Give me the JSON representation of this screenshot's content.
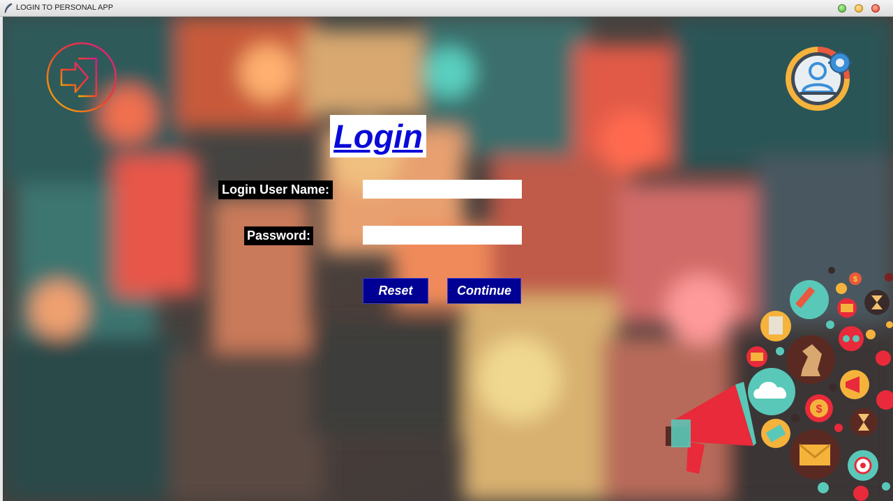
{
  "window": {
    "title": "LOGIN TO PERSONAL APP"
  },
  "login": {
    "heading": "Login",
    "username_label": "Login User Name:",
    "username_value": "",
    "password_label": "Password:",
    "password_value": "",
    "reset_label": "Reset",
    "continue_label": "Continue"
  },
  "colors": {
    "heading_text": "#0a0ad8",
    "button_bg": "#000094",
    "label_bg": "#000000"
  },
  "icons": [
    "feather-app-icon",
    "logout-icon",
    "user-settings-icon",
    "marketing-illustration"
  ]
}
